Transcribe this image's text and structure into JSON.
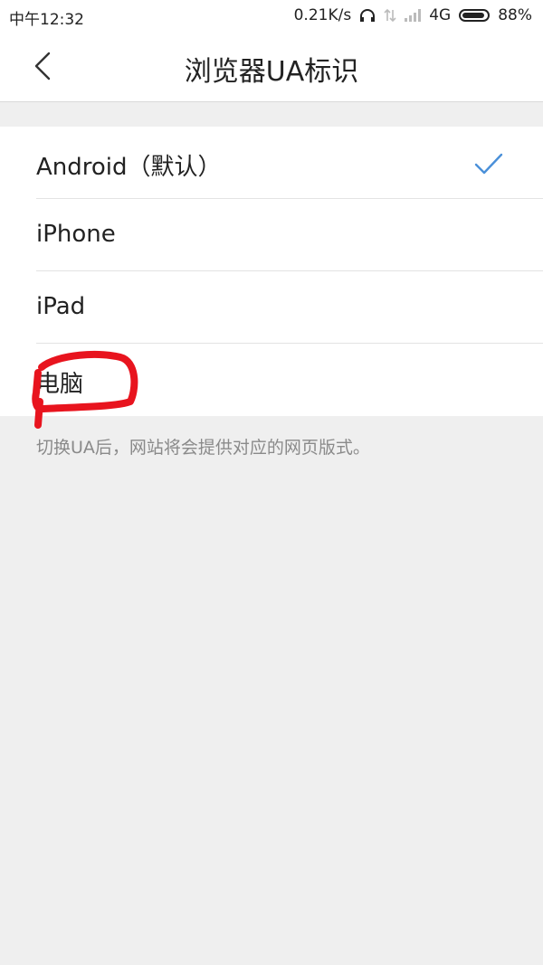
{
  "status": {
    "time": "中午12:32",
    "net_speed": "0.21K/s",
    "network": "4G",
    "battery": "88%"
  },
  "header": {
    "title": "浏览器UA标识",
    "back_icon": "chevron-left-icon"
  },
  "ua_options": [
    {
      "label": "Android（默认）",
      "selected": true
    },
    {
      "label": "iPhone",
      "selected": false
    },
    {
      "label": "iPad",
      "selected": false
    },
    {
      "label": "电脑",
      "selected": false
    }
  ],
  "hint": "切换UA后，网站将会提供对应的网页版式。",
  "colors": {
    "accent": "#4a90d9",
    "annotation": "#e8141e"
  }
}
